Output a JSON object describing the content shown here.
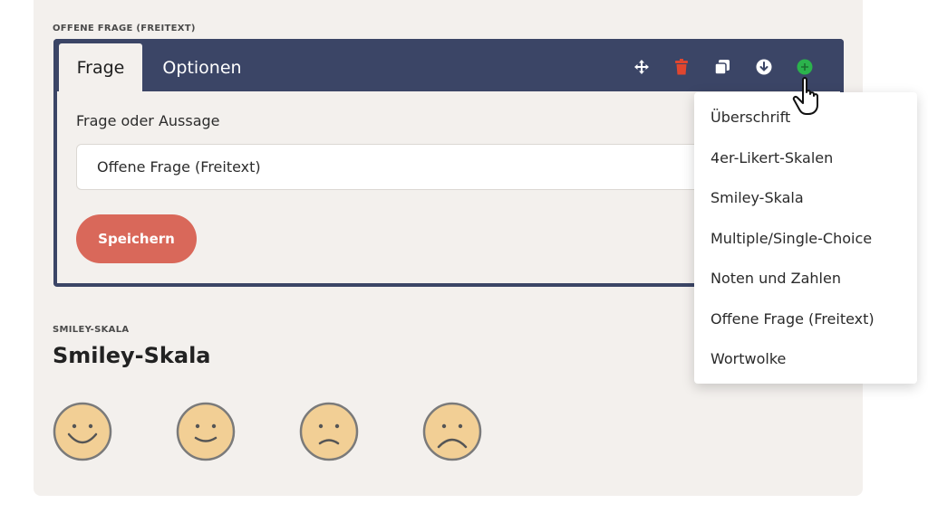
{
  "open_question": {
    "section_label": "OFFENE FRAGE (FREITEXT)",
    "tabs": [
      {
        "label": "Frage"
      },
      {
        "label": "Optionen"
      }
    ],
    "toolbar_icons": [
      "move-icon",
      "trash-icon",
      "duplicate-icon",
      "download-icon",
      "add-icon"
    ],
    "field_label": "Frage oder Aussage",
    "field_value": "Offene Frage (Freitext)",
    "save_label": "Speichern"
  },
  "smiley_question": {
    "section_label": "SMILEY-SKALA",
    "title": "Smiley-Skala",
    "smileys": [
      "very-happy-face-icon",
      "happy-face-icon",
      "sad-face-icon",
      "very-sad-face-icon"
    ]
  },
  "add_menu": {
    "items": [
      {
        "label": "Überschrift"
      },
      {
        "label": "4er-Likert-Skalen"
      },
      {
        "label": "Smiley-Skala"
      },
      {
        "label": "Multiple/Single-Choice"
      },
      {
        "label": "Noten und Zahlen"
      },
      {
        "label": "Offene Frage (Freitext)"
      },
      {
        "label": "Wortwolke"
      }
    ]
  },
  "colors": {
    "toolbar": "#3b4566",
    "panel": "#f3f0ed",
    "save_button": "#d9685a",
    "trash": "#e0462f",
    "add": "#2bb24c",
    "smiley_fill": "#f2cf95"
  }
}
